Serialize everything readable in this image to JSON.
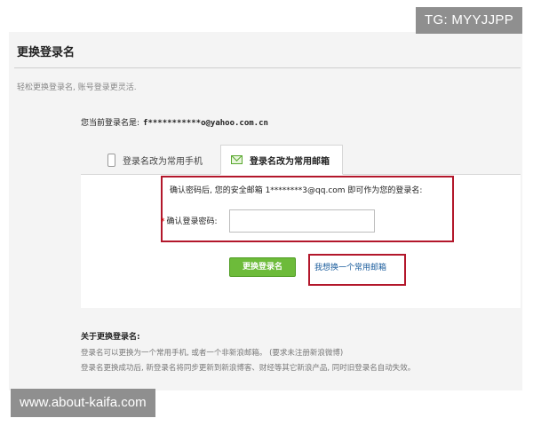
{
  "watermarks": {
    "top": "TG: MYYJJPP",
    "bottom": "www.about-kaifa.com"
  },
  "page": {
    "title": "更换登录名",
    "subtitle": "轻松更换登录名, 账号登录更灵活."
  },
  "current": {
    "label": "您当前登录名是:",
    "value": "f***********o@yahoo.com.cn"
  },
  "tabs": [
    {
      "label": "登录名改为常用手机",
      "icon": "phone-icon",
      "active": false
    },
    {
      "label": "登录名改为常用邮箱",
      "icon": "mail-icon",
      "active": true
    }
  ],
  "form": {
    "info": "确认密码后, 您的安全邮箱 1********3@qq.com 即可作为您的登录名:",
    "password_label": "确认登录密码:",
    "password_value": "",
    "submit_label": "更换登录名",
    "alt_link": "我想换一个常用邮箱"
  },
  "about": {
    "title": "关于更换登录名:",
    "line1": "登录名可以更换为一个常用手机, 或者一个非新浪邮箱。 (要求未注册新浪微博)",
    "line2": "登录名更换成功后, 新登录名将同步更新到新浪博客、财经等其它新浪产品, 同时旧登录名自动失效。"
  },
  "colors": {
    "accent_green": "#6dbb3a",
    "highlight_red": "#b3172b",
    "link_blue": "#1a5c9c"
  }
}
